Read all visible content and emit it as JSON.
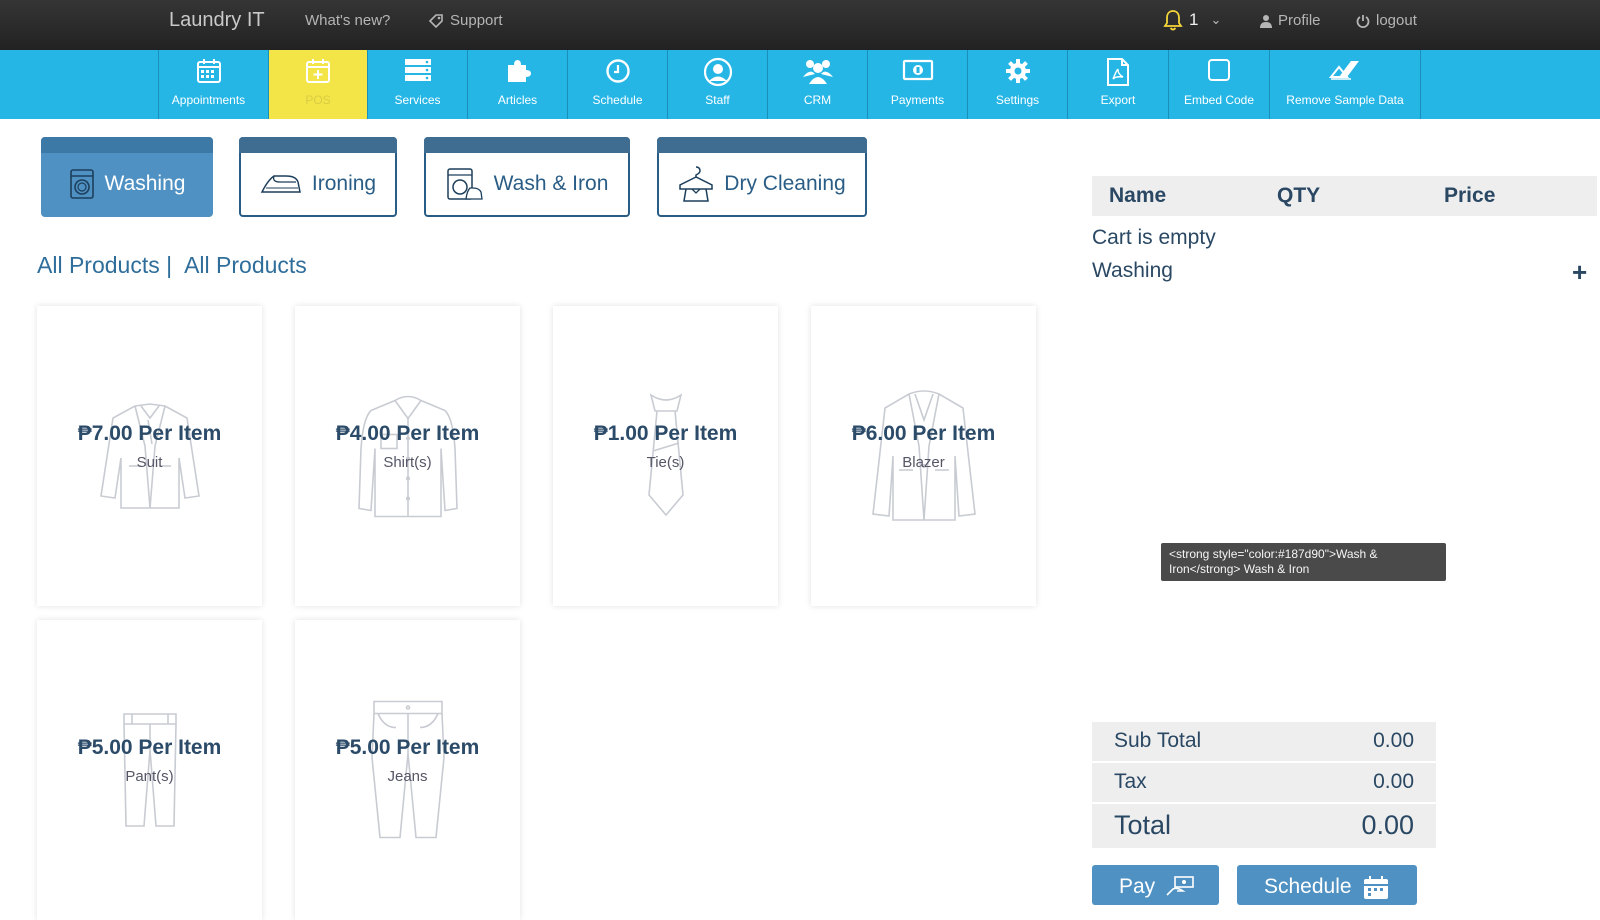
{
  "topbar": {
    "brand": "Laundry IT",
    "whats_new": "What's new?",
    "support": "Support",
    "notifications_count": "1",
    "profile": "Profile",
    "logout": "logout"
  },
  "nav": {
    "items": [
      {
        "label": "Appointments",
        "icon": "calendar-icon"
      },
      {
        "label": "POS",
        "icon": "calendar-plus-icon"
      },
      {
        "label": "Services",
        "icon": "list-icon"
      },
      {
        "label": "Articles",
        "icon": "puzzle-icon"
      },
      {
        "label": "Schedule",
        "icon": "clock-icon"
      },
      {
        "label": "Staff",
        "icon": "user-circle-icon"
      },
      {
        "label": "CRM",
        "icon": "users-icon"
      },
      {
        "label": "Payments",
        "icon": "money-icon"
      },
      {
        "label": "Settings",
        "icon": "gear-icon"
      },
      {
        "label": "Export",
        "icon": "pdf-icon"
      },
      {
        "label": "Embed Code",
        "icon": "square-icon"
      },
      {
        "label": "Remove Sample Data",
        "icon": "eraser-icon"
      }
    ],
    "active": "POS",
    "colors": {
      "bar": "#25b6e6",
      "active": "#f3e547"
    }
  },
  "categories": [
    {
      "label": "Washing",
      "icon": "washing-machine-icon",
      "active": true
    },
    {
      "label": "Ironing",
      "icon": "iron-icon",
      "active": false
    },
    {
      "label": "Wash & Iron",
      "icon": "wash-iron-icon",
      "active": false
    },
    {
      "label": "Dry Cleaning",
      "icon": "dry-cleaning-icon",
      "active": false
    }
  ],
  "breadcrumb": {
    "first": "All Products |",
    "second": "All Products"
  },
  "products": [
    {
      "price": "₱7.00 Per Item",
      "name": "Suit",
      "icon": "suit-icon"
    },
    {
      "price": "₱4.00 Per Item",
      "name": "Shirt(s)",
      "icon": "shirt-icon"
    },
    {
      "price": "₱1.00 Per Item",
      "name": "Tie(s)",
      "icon": "tie-icon"
    },
    {
      "price": "₱6.00 Per Item",
      "name": "Blazer",
      "icon": "blazer-icon"
    },
    {
      "price": "₱5.00 Per Item",
      "name": "Pant(s)",
      "icon": "pants-icon"
    },
    {
      "price": "₱5.00 Per Item",
      "name": "Jeans",
      "icon": "jeans-icon"
    }
  ],
  "cart": {
    "columns": {
      "name": "Name",
      "qty": "QTY",
      "price": "Price"
    },
    "empty_text": "Cart is empty",
    "category": "Washing",
    "tooltip": "<strong style=\"color:#187d90\">Wash & Iron</strong> Wash & Iron",
    "subtotal_label": "Sub Total",
    "subtotal_value": "0.00",
    "tax_label": "Tax",
    "tax_value": "0.00",
    "total_label": "Total",
    "total_value": "0.00"
  },
  "buttons": {
    "pay": "Pay",
    "schedule": "Schedule"
  }
}
